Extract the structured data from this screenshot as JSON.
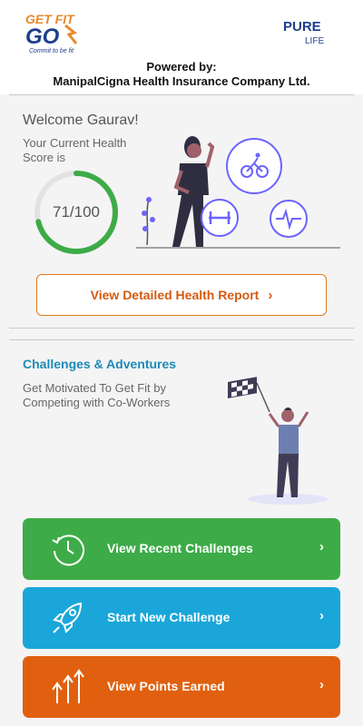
{
  "header": {
    "logo_main_text": "GET FIT GO",
    "logo_tagline": "Commit to be fit",
    "partner_logo_top": "PURE",
    "partner_logo_bottom": "LIFE",
    "powered_by_label": "Powered by:",
    "company_name": "ManipalCigna Health Insurance Company Ltd."
  },
  "health": {
    "welcome": "Welcome Gaurav!",
    "score_caption": "Your Current Health Score is",
    "score_display": "71/100",
    "score_value": 71,
    "score_max": 100,
    "report_button_label": "View Detailed Health Report"
  },
  "challenges": {
    "title": "Challenges & Adventures",
    "subtitle": "Get Motivated To Get Fit by Competing with Co-Workers",
    "actions": [
      {
        "label": "View Recent Challenges",
        "icon": "history-clock-icon",
        "color": "#3dab47"
      },
      {
        "label": "Start New Challenge",
        "icon": "rocket-icon",
        "color": "#1aa6d8"
      },
      {
        "label": "View Points Earned",
        "icon": "up-arrows-icon",
        "color": "#e1600f"
      }
    ]
  },
  "colors": {
    "accent_orange": "#d45a12",
    "section_blue": "#1d8ab8",
    "score_green": "#3dab47"
  },
  "chevron_glyph": "›"
}
